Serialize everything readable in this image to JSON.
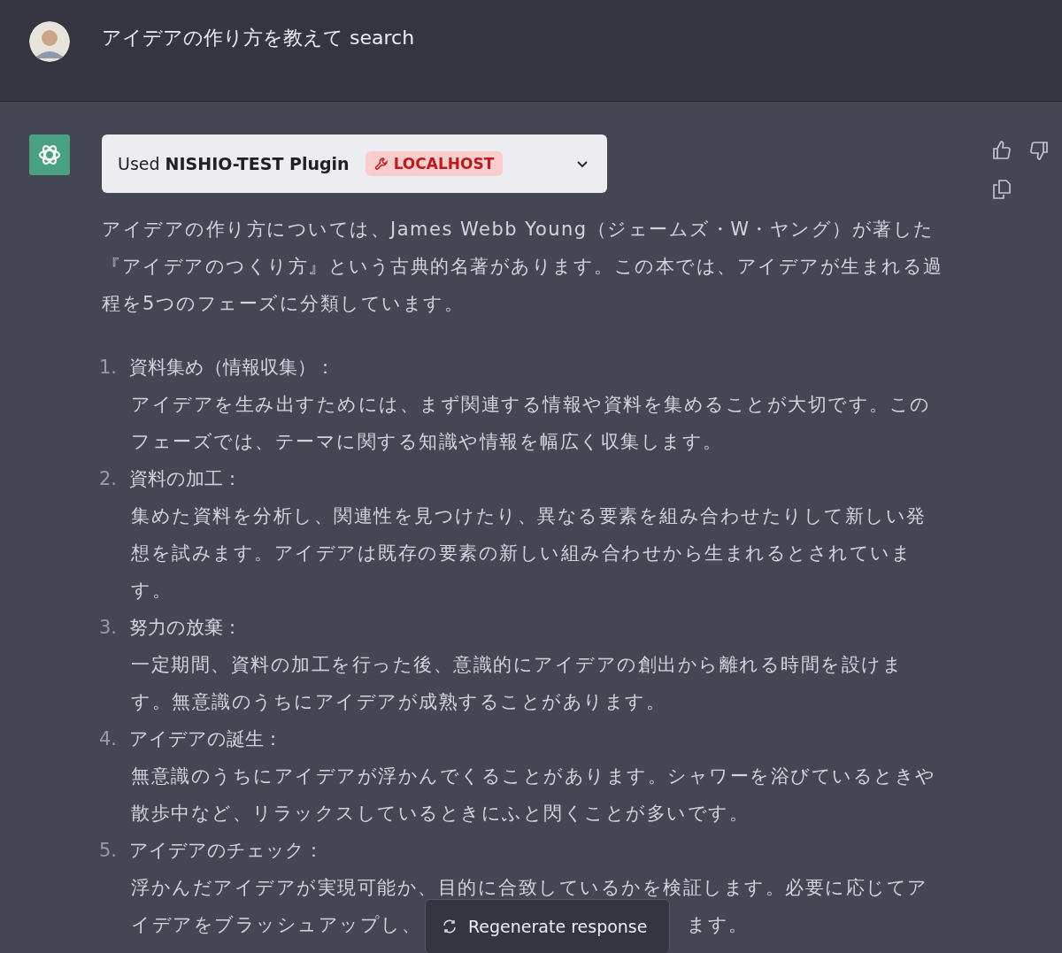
{
  "user_message": {
    "text": "アイデアの作り方を教えて search"
  },
  "assistant": {
    "plugin": {
      "used": "Used",
      "name": "NISHIO-TEST Plugin",
      "badge": "LOCALHOST",
      "expanded": false
    },
    "intro": [
      "アイデアの作り方については、James Webb Young（ジェームズ・W・ヤング）が著した",
      "『アイデアのつくり方』という古典的名著があります。この本では、アイデアが生まれる過",
      "程を5つのフェーズに分類しています。"
    ],
    "steps": [
      {
        "number": "1.",
        "title": "資料集め（情報収集）：",
        "lines": [
          [
            "アイデアを生み出すためには、まず関連する情報や資料を集めることが大切です。この"
          ],
          [
            "フェーズでは、テーマに関する知識や情報を幅広く収集します。"
          ]
        ]
      },
      {
        "number": "2.",
        "title": "資料の加工：",
        "lines": [
          [
            "集めた資料を分析し、関連性を見つけたり、異なる要素を組み合わせたりして新しい発"
          ],
          [
            "想を試みます。アイデアは既存の要素の新しい組み合わせから生まれるとされていま"
          ],
          [
            "す。"
          ]
        ]
      },
      {
        "number": "3.",
        "title": "努力の放棄：",
        "lines": [
          [
            "一定期間、資料の加工を行った後、意識的にアイデアの創出から離れる時間を設けま"
          ],
          [
            "す。無意識のうちにアイデアが成熟することがあります。"
          ]
        ]
      },
      {
        "number": "4.",
        "title": "アイデアの誕生：",
        "lines": [
          [
            "無意識のうちにアイデアが浮かんでくることがあります。シャワーを浴びているときや"
          ],
          [
            "散歩中など、リラックスしているときにふと閃くことが多いです。"
          ]
        ]
      },
      {
        "number": "5.",
        "title": "アイデアのチェック：",
        "lines": [
          [
            "浮かんだアイデアが実現可能か、目的に合致しているかを検証します。必要に応じてア"
          ],
          [
            "イデアをブラッシュアップし、",
            "ます。"
          ]
        ]
      }
    ]
  },
  "regenerate_button": {
    "label": "Regenerate response"
  }
}
